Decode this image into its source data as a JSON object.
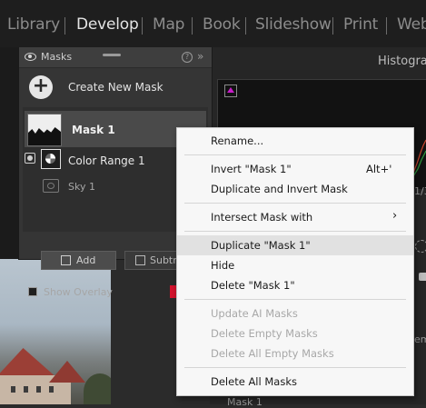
{
  "topnav": {
    "tabs": [
      {
        "label": "Library",
        "active": false
      },
      {
        "label": "Develop",
        "active": true
      },
      {
        "label": "Map",
        "active": false
      },
      {
        "label": "Book",
        "active": false
      },
      {
        "label": "Slideshow",
        "active": false
      },
      {
        "label": "Print",
        "active": false
      },
      {
        "label": "Web",
        "active": false
      }
    ]
  },
  "right_panel": {
    "histogram_title": "Histogra",
    "peek_number": "1/3",
    "peek_label": "em",
    "bottom_mask_label": "Mask 1"
  },
  "masks_panel": {
    "title": "Masks",
    "help_glyph": "?",
    "collapse_glyph": "»",
    "create_glyph": "+",
    "create_label": "Create New Mask",
    "mask_name": "Mask 1",
    "component_name": "Color Range 1",
    "sky_name": "Sky 1",
    "add_label": "Add",
    "subtract_label": "Subtra",
    "show_overlay_label": "Show Overlay",
    "show_overlay_checked": false,
    "overlay_color": "#d3122c"
  },
  "context_menu": {
    "rename": "Rename...",
    "invert": "Invert \"Mask 1\"",
    "invert_shortcut": "Alt+'",
    "duplicate_invert": "Duplicate and Invert Mask",
    "intersect": "Intersect Mask with",
    "intersect_arrow": "›",
    "duplicate": "Duplicate \"Mask 1\"",
    "hide": "Hide",
    "delete": "Delete \"Mask 1\"",
    "update_ai": "Update AI Masks",
    "delete_empty": "Delete Empty Masks",
    "delete_all_empty": "Delete All Empty Masks",
    "delete_all": "Delete All Masks"
  }
}
